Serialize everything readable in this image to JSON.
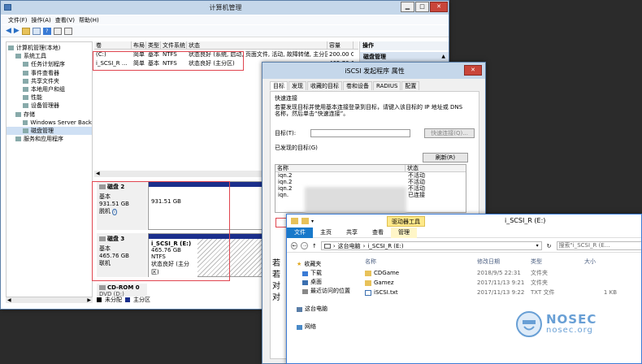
{
  "cm": {
    "title": "计算机管理",
    "menu": [
      "文件(F)",
      "操作(A)",
      "查看(V)",
      "帮助(H)"
    ],
    "tree": [
      {
        "l": "计算机管理(本地)",
        "ind": 0
      },
      {
        "l": "系统工具",
        "ind": 1
      },
      {
        "l": "任务计划程序",
        "ind": 2
      },
      {
        "l": "事件查看器",
        "ind": 2
      },
      {
        "l": "共享文件夹",
        "ind": 2
      },
      {
        "l": "本地用户和组",
        "ind": 2
      },
      {
        "l": "性能",
        "ind": 2
      },
      {
        "l": "设备管理器",
        "ind": 2
      },
      {
        "l": "存储",
        "ind": 1
      },
      {
        "l": "Windows Server Back",
        "ind": 2
      },
      {
        "l": "磁盘管理",
        "ind": 2
      },
      {
        "l": "服务和应用程序",
        "ind": 1
      }
    ],
    "vol_headers": [
      "卷",
      "布局",
      "类型",
      "文件系统",
      "状态",
      "容量"
    ],
    "volumes": [
      {
        "vol": "(C:)",
        "layout": "简单",
        "type": "基本",
        "fs": "NTFS",
        "status": "状态良好 (系统, 启动, 页面文件, 活动, 故障转储, 主分区)",
        "cap": "200.00 GI"
      },
      {
        "vol": "i_SCSI_R ...",
        "layout": "简单",
        "type": "基本",
        "fs": "NTFS",
        "status": "状态良好 (主分区)",
        "cap": "465.76 GI"
      }
    ],
    "actions": {
      "title": "操作",
      "item": "磁盘管理"
    },
    "disk2": {
      "name": "磁盘 2",
      "type": "基本",
      "size": "931.51 GB",
      "state": "脱机",
      "vol_size": "931.51 GB"
    },
    "disk3": {
      "name": "磁盘 3",
      "type": "基本",
      "size": "465.76 GB",
      "state": "联机",
      "vol_name": "i_SCSI_R  (E:)",
      "vol_fs": "465.76 GB NTFS",
      "vol_status": "状态良好 (主分区)"
    },
    "cdrom": {
      "name": "CD-ROM 0",
      "sub": "DVD (D:)"
    },
    "legend": {
      "unalloc": "未分配",
      "primary": "主分区"
    }
  },
  "iscsi": {
    "title": "iSCSI 发起程序 属性",
    "tabs": [
      "目标",
      "发现",
      "收藏的目标",
      "卷和设备",
      "RADIUS",
      "配置"
    ],
    "quick_title": "快速连接",
    "quick_desc": "若要发现目标并使用基本连接登录到目标，请键入该目标的 IP 地址或 DNS 名称，然后单击“快速连接”。",
    "target_label": "目标(T):",
    "quick_btn": "快速连接(Q)...",
    "discovered_label": "已发现的目标(G)",
    "refresh_btn": "刷新(R)",
    "col_name": "名称",
    "col_status": "状态",
    "targets": [
      {
        "name": "iqn.2",
        "status": "不活动"
      },
      {
        "name": "iqn.2",
        "status": "不活动"
      },
      {
        "name": "iqn.2",
        "status": "不活动"
      },
      {
        "name": "iqn.",
        "status": "已连接"
      }
    ],
    "side_text": [
      "若",
      "若",
      "对",
      "对"
    ]
  },
  "fx": {
    "title": "i_SCSI_R (E:)",
    "ribbon_ctx": "驱动器工具",
    "tabs": [
      "文件",
      "主页",
      "共享",
      "查看",
      "管理"
    ],
    "path": [
      "这台电脑",
      "i_SCSI_R (E:)"
    ],
    "search": "搜索\"i_SCSI_R (E...",
    "cols": [
      "名称",
      "修改日期",
      "类型",
      "大小"
    ],
    "nav": [
      "收藏夹",
      "下载",
      "桌面",
      "最近访问的位置",
      "这台电脑",
      "网络"
    ],
    "files": [
      {
        "name": "CDGame",
        "date": "2018/9/5 22:31",
        "type": "文件夹",
        "size": ""
      },
      {
        "name": "Gamez",
        "date": "2017/11/13 9:21",
        "type": "文件夹",
        "size": ""
      },
      {
        "name": "iSCSI.txt",
        "date": "2017/11/13 9:22",
        "type": "TXT 文件",
        "size": "1 KB"
      }
    ]
  },
  "watermark": {
    "name": "NOSEC",
    "url": "nosec.org"
  }
}
